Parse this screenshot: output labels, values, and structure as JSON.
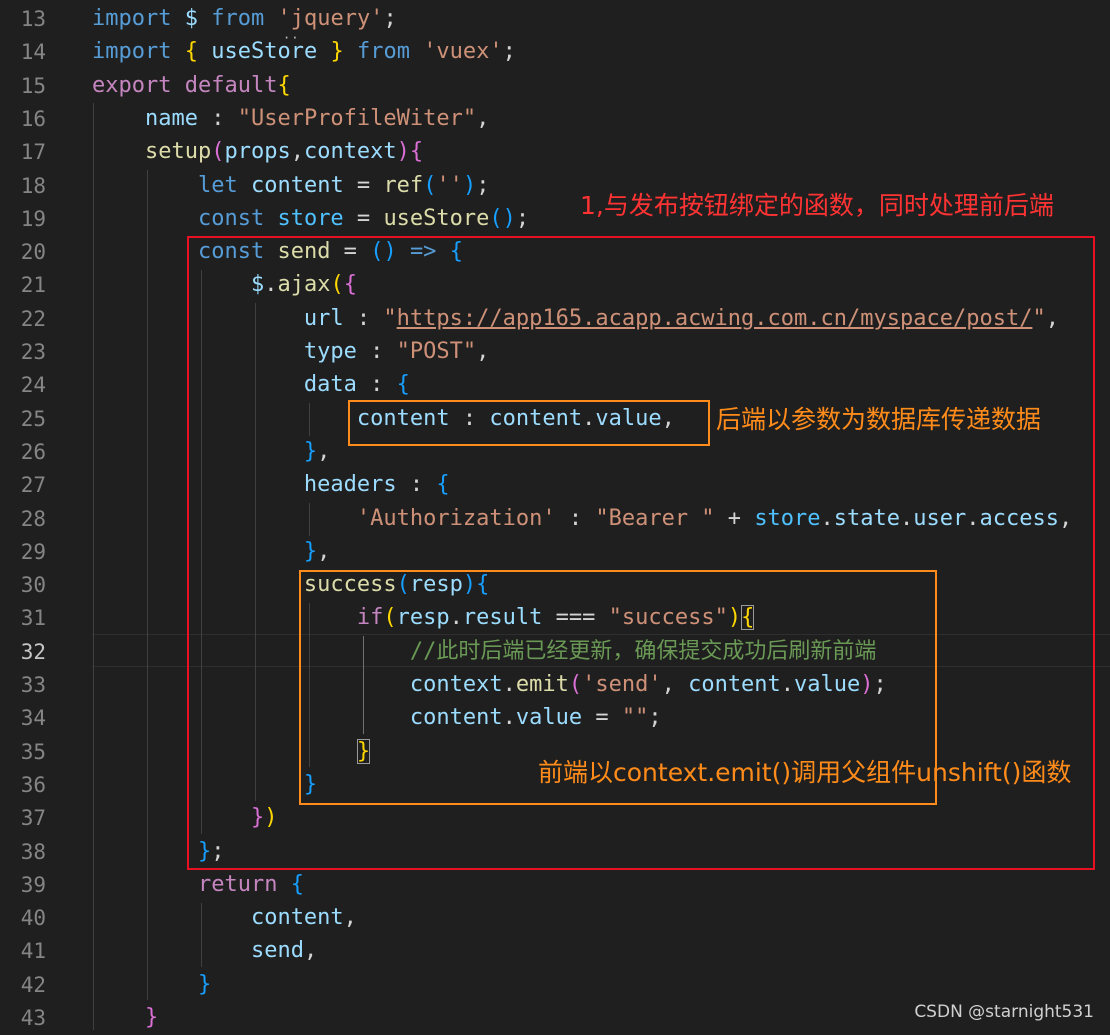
{
  "editor": {
    "active_line": "32",
    "lines": [
      {
        "number": "13",
        "tokens": [
          [
            "kw",
            "import"
          ],
          [
            "p",
            " "
          ],
          [
            "var",
            "$"
          ],
          [
            "p",
            " "
          ],
          [
            "kw",
            "from"
          ],
          [
            "p",
            " "
          ],
          [
            "str",
            "'jquery'"
          ],
          [
            "p",
            ";"
          ]
        ]
      },
      {
        "number": "14",
        "tokens": [
          [
            "kw",
            "import"
          ],
          [
            "p",
            " "
          ],
          [
            "b1",
            "{"
          ],
          [
            "p",
            " "
          ],
          [
            "var",
            "useStore"
          ],
          [
            "p",
            " "
          ],
          [
            "b1",
            "}"
          ],
          [
            "p",
            " "
          ],
          [
            "kw",
            "from"
          ],
          [
            "p",
            " "
          ],
          [
            "str",
            "'vuex'"
          ],
          [
            "p",
            ";"
          ]
        ]
      },
      {
        "number": "15",
        "tokens": [
          [
            "ctl",
            "export"
          ],
          [
            "p",
            " "
          ],
          [
            "ctl",
            "default"
          ],
          [
            "b1",
            "{"
          ]
        ]
      },
      {
        "number": "16",
        "tokens": [
          [
            "p",
            "    "
          ],
          [
            "var",
            "name"
          ],
          [
            "p",
            " : "
          ],
          [
            "str",
            "\"UserProfileWiter\""
          ],
          [
            "p",
            ","
          ]
        ]
      },
      {
        "number": "17",
        "tokens": [
          [
            "p",
            "    "
          ],
          [
            "fn",
            "setup"
          ],
          [
            "b2",
            "("
          ],
          [
            "var",
            "props"
          ],
          [
            "p",
            ","
          ],
          [
            "var",
            "context"
          ],
          [
            "b2",
            ")"
          ],
          [
            "b2",
            "{"
          ]
        ]
      },
      {
        "number": "18",
        "tokens": [
          [
            "p",
            "        "
          ],
          [
            "kw",
            "let"
          ],
          [
            "p",
            " "
          ],
          [
            "var",
            "content"
          ],
          [
            "p",
            " = "
          ],
          [
            "fn",
            "ref"
          ],
          [
            "b3",
            "("
          ],
          [
            "str",
            "''"
          ],
          [
            "b3",
            ")"
          ],
          [
            "p",
            ";"
          ]
        ]
      },
      {
        "number": "19",
        "tokens": [
          [
            "p",
            "        "
          ],
          [
            "kw",
            "const"
          ],
          [
            "p",
            " "
          ],
          [
            "cst",
            "store"
          ],
          [
            "p",
            " = "
          ],
          [
            "fn",
            "useStore"
          ],
          [
            "b3",
            "("
          ],
          [
            "b3",
            ")"
          ],
          [
            "p",
            ";"
          ]
        ]
      },
      {
        "number": "20",
        "tokens": [
          [
            "p",
            "        "
          ],
          [
            "kw",
            "const"
          ],
          [
            "p",
            " "
          ],
          [
            "fn",
            "send"
          ],
          [
            "p",
            " = "
          ],
          [
            "b3",
            "("
          ],
          [
            "b3",
            ")"
          ],
          [
            "p",
            " "
          ],
          [
            "kw",
            "=>"
          ],
          [
            "p",
            " "
          ],
          [
            "b3",
            "{"
          ]
        ]
      },
      {
        "number": "21",
        "tokens": [
          [
            "p",
            "            "
          ],
          [
            "var",
            "$"
          ],
          [
            "p",
            "."
          ],
          [
            "fn",
            "ajax"
          ],
          [
            "b1",
            "("
          ],
          [
            "b2",
            "{"
          ]
        ]
      },
      {
        "number": "22",
        "tokens": [
          [
            "p",
            "                "
          ],
          [
            "var",
            "url"
          ],
          [
            "p",
            " : "
          ],
          [
            "str",
            "\""
          ],
          [
            "str ul",
            "https://app165.acapp.acwing.com.cn/myspace/post/"
          ],
          [
            "str",
            "\""
          ],
          [
            "p",
            ","
          ]
        ]
      },
      {
        "number": "23",
        "tokens": [
          [
            "p",
            "                "
          ],
          [
            "var",
            "type"
          ],
          [
            "p",
            " : "
          ],
          [
            "str",
            "\"POST\""
          ],
          [
            "p",
            ","
          ]
        ]
      },
      {
        "number": "24",
        "tokens": [
          [
            "p",
            "                "
          ],
          [
            "var",
            "data"
          ],
          [
            "p",
            " : "
          ],
          [
            "b3",
            "{"
          ]
        ]
      },
      {
        "number": "25",
        "tokens": [
          [
            "p",
            "                    "
          ],
          [
            "var",
            "content"
          ],
          [
            "p",
            " : "
          ],
          [
            "var",
            "content"
          ],
          [
            "p",
            "."
          ],
          [
            "var",
            "value"
          ],
          [
            "p",
            ","
          ]
        ]
      },
      {
        "number": "26",
        "tokens": [
          [
            "p",
            "                "
          ],
          [
            "b3",
            "}"
          ],
          [
            "p",
            ","
          ]
        ]
      },
      {
        "number": "27",
        "tokens": [
          [
            "p",
            "                "
          ],
          [
            "var",
            "headers"
          ],
          [
            "p",
            " : "
          ],
          [
            "b3",
            "{"
          ]
        ]
      },
      {
        "number": "28",
        "tokens": [
          [
            "p",
            "                    "
          ],
          [
            "str",
            "'Authorization'"
          ],
          [
            "p",
            " : "
          ],
          [
            "str",
            "\"Bearer \""
          ],
          [
            "p",
            " + "
          ],
          [
            "cst",
            "store"
          ],
          [
            "p",
            "."
          ],
          [
            "var",
            "state"
          ],
          [
            "p",
            "."
          ],
          [
            "var",
            "user"
          ],
          [
            "p",
            "."
          ],
          [
            "var",
            "access"
          ],
          [
            "p",
            ","
          ]
        ]
      },
      {
        "number": "29",
        "tokens": [
          [
            "p",
            "                "
          ],
          [
            "b3",
            "}"
          ],
          [
            "p",
            ","
          ]
        ]
      },
      {
        "number": "30",
        "tokens": [
          [
            "p",
            "                "
          ],
          [
            "fn",
            "success"
          ],
          [
            "b3",
            "("
          ],
          [
            "var",
            "resp"
          ],
          [
            "b3",
            ")"
          ],
          [
            "b3",
            "{"
          ]
        ]
      },
      {
        "number": "31",
        "tokens": [
          [
            "p",
            "                    "
          ],
          [
            "ctl",
            "if"
          ],
          [
            "b1",
            "("
          ],
          [
            "var",
            "resp"
          ],
          [
            "p",
            "."
          ],
          [
            "var",
            "result"
          ],
          [
            "p",
            " === "
          ],
          [
            "str",
            "\"success\""
          ],
          [
            "b1",
            ")"
          ],
          [
            "b1 bm",
            "{"
          ]
        ]
      },
      {
        "number": "32",
        "tokens": [
          [
            "p",
            "                        "
          ],
          [
            "cmt",
            "//此时后端已经更新，确保提交成功后刷新前端"
          ]
        ]
      },
      {
        "number": "33",
        "tokens": [
          [
            "p",
            "                        "
          ],
          [
            "var",
            "context"
          ],
          [
            "p",
            "."
          ],
          [
            "fn",
            "emit"
          ],
          [
            "b2",
            "("
          ],
          [
            "str",
            "'send'"
          ],
          [
            "p",
            ", "
          ],
          [
            "var",
            "content"
          ],
          [
            "p",
            "."
          ],
          [
            "var",
            "value"
          ],
          [
            "b2",
            ")"
          ],
          [
            "p",
            ";"
          ]
        ]
      },
      {
        "number": "34",
        "tokens": [
          [
            "p",
            "                        "
          ],
          [
            "var",
            "content"
          ],
          [
            "p",
            "."
          ],
          [
            "var",
            "value"
          ],
          [
            "p",
            " = "
          ],
          [
            "str",
            "\"\""
          ],
          [
            "p",
            ";"
          ]
        ]
      },
      {
        "number": "35",
        "tokens": [
          [
            "p",
            "                    "
          ],
          [
            "b1 bm",
            "}"
          ]
        ]
      },
      {
        "number": "36",
        "tokens": [
          [
            "p",
            "                "
          ],
          [
            "b3",
            "}"
          ]
        ]
      },
      {
        "number": "37",
        "tokens": [
          [
            "p",
            "            "
          ],
          [
            "b2",
            "}"
          ],
          [
            "b1",
            ")"
          ]
        ]
      },
      {
        "number": "38",
        "tokens": [
          [
            "p",
            "        "
          ],
          [
            "b3",
            "}"
          ],
          [
            "p",
            ";"
          ]
        ]
      },
      {
        "number": "39",
        "tokens": [
          [
            "p",
            "        "
          ],
          [
            "ctl",
            "return"
          ],
          [
            "p",
            " "
          ],
          [
            "b3",
            "{"
          ]
        ]
      },
      {
        "number": "40",
        "tokens": [
          [
            "p",
            "            "
          ],
          [
            "var",
            "content"
          ],
          [
            "p",
            ","
          ]
        ]
      },
      {
        "number": "41",
        "tokens": [
          [
            "p",
            "            "
          ],
          [
            "var",
            "send"
          ],
          [
            "p",
            ","
          ]
        ]
      },
      {
        "number": "42",
        "tokens": [
          [
            "p",
            "        "
          ],
          [
            "b3",
            "}"
          ]
        ]
      },
      {
        "number": "43",
        "tokens": [
          [
            "p",
            "    "
          ],
          [
            "b2",
            "}"
          ]
        ]
      }
    ]
  },
  "annotations": {
    "red_note": "1,与发布按钮绑定的函数，同时处理前后端",
    "data_note": "后端以参数为数据库传递数据",
    "success_note": "前端以context.emit()调用父组件unshift()函数"
  },
  "watermark": "CSDN @starnight531",
  "colors": {
    "background": "#1f1f1f",
    "annotation_red": "#e81123",
    "annotation_orange": "#ff8c1a"
  }
}
